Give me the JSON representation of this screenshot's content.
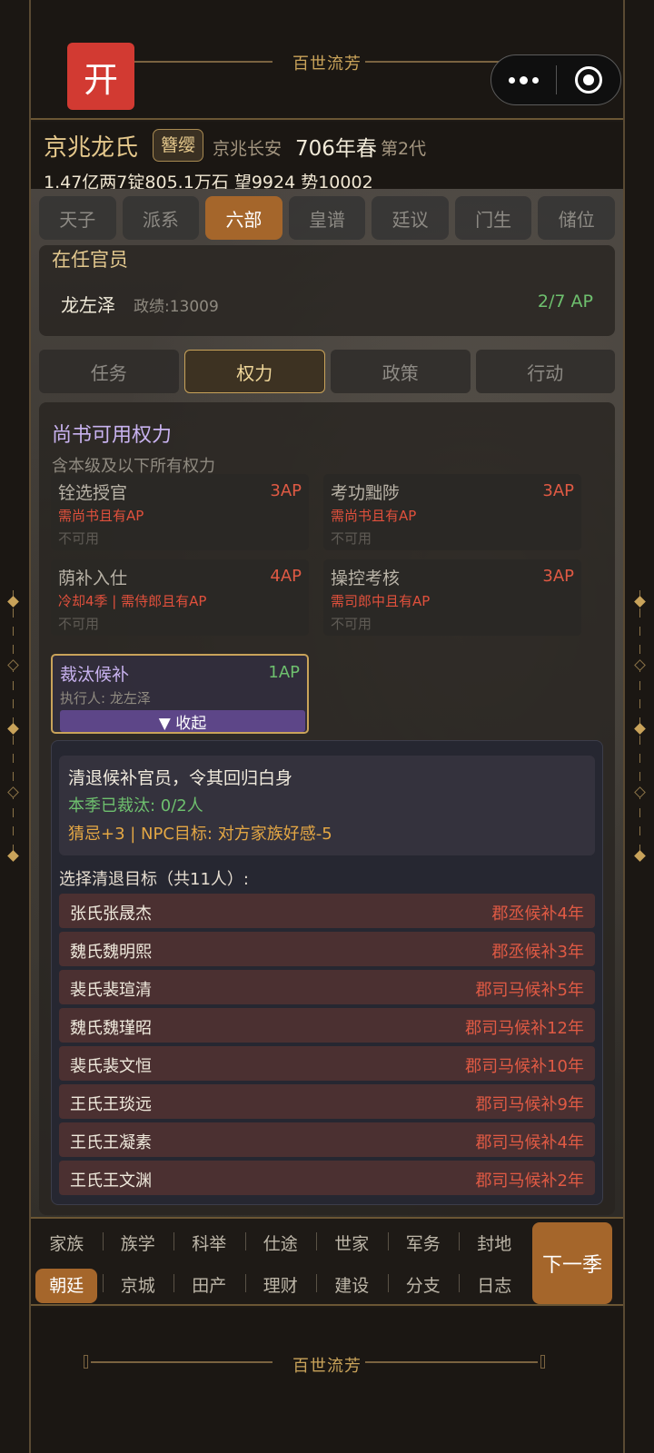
{
  "app": {
    "title": "百世流芳",
    "open_label": "开",
    "footer_title": "百世流芳"
  },
  "clan": {
    "name": "京兆龙氏",
    "rank": "簪缨",
    "home": "京兆长安",
    "year": "706年春",
    "generation": "第2代",
    "wealth": "1.47亿两7锭805.1万石  望9924 势10002"
  },
  "top_tabs": [
    "天子",
    "派系",
    "六部",
    "皇谱",
    "廷议",
    "门生",
    "储位"
  ],
  "top_tabs_active": "六部",
  "officials": {
    "title": "在任官员",
    "name": "龙左泽",
    "score": "政绩:13009",
    "ap": "2/7 AP"
  },
  "sub_tabs": [
    "任务",
    "权力",
    "政策",
    "行动"
  ],
  "sub_tabs_active": "权力",
  "power": {
    "title": "尚书可用权力",
    "subtitle": "含本级及以下所有权力",
    "cards": [
      {
        "name": "铨选授官",
        "cost": "3AP",
        "req": "需尚书且有AP",
        "state": "不可用"
      },
      {
        "name": "考功黜陟",
        "cost": "3AP",
        "req": "需尚书且有AP",
        "state": "不可用"
      },
      {
        "name": "荫补入仕",
        "cost": "4AP",
        "req": "冷却4季 | 需侍郎且有AP",
        "state": "不可用"
      },
      {
        "name": "操控考核",
        "cost": "3AP",
        "req": "需司郎中且有AP",
        "state": "不可用"
      }
    ],
    "active_card": {
      "name": "裁汰候补",
      "cost": "1AP",
      "executor": "执行人: 龙左泽",
      "collapse": "▼ 收起"
    }
  },
  "detail": {
    "desc": "清退候补官员，令其回归白身",
    "progress": "本季已裁汰: 0/2人",
    "effect": "猜忌+3 | NPC目标: 对方家族好感-5",
    "choose_label": "选择清退目标（共11人）:",
    "targets": [
      {
        "name": "张氏张晟杰",
        "info": "郡丞候补4年"
      },
      {
        "name": "魏氏魏明熙",
        "info": "郡丞候补3年"
      },
      {
        "name": "裴氏裴瑄清",
        "info": "郡司马候补5年"
      },
      {
        "name": "魏氏魏瑾昭",
        "info": "郡司马候补12年"
      },
      {
        "name": "裴氏裴文恒",
        "info": "郡司马候补10年"
      },
      {
        "name": "王氏王琰远",
        "info": "郡司马候补9年"
      },
      {
        "name": "王氏王凝素",
        "info": "郡司马候补4年"
      },
      {
        "name": "王氏王文渊",
        "info": "郡司马候补2年"
      }
    ]
  },
  "bottom_nav": {
    "row1": [
      "家族",
      "族学",
      "科举",
      "仕途",
      "世家",
      "军务",
      "封地"
    ],
    "row2": [
      "朝廷",
      "京城",
      "田产",
      "理财",
      "建设",
      "分支",
      "日志"
    ],
    "active": "朝廷",
    "next": "下一季"
  },
  "colors": {
    "accent": "#a5662b",
    "gold": "#c9a35a",
    "warning": "#e05a44",
    "positive": "#6ec06e",
    "purple": "#c8b2ef"
  }
}
